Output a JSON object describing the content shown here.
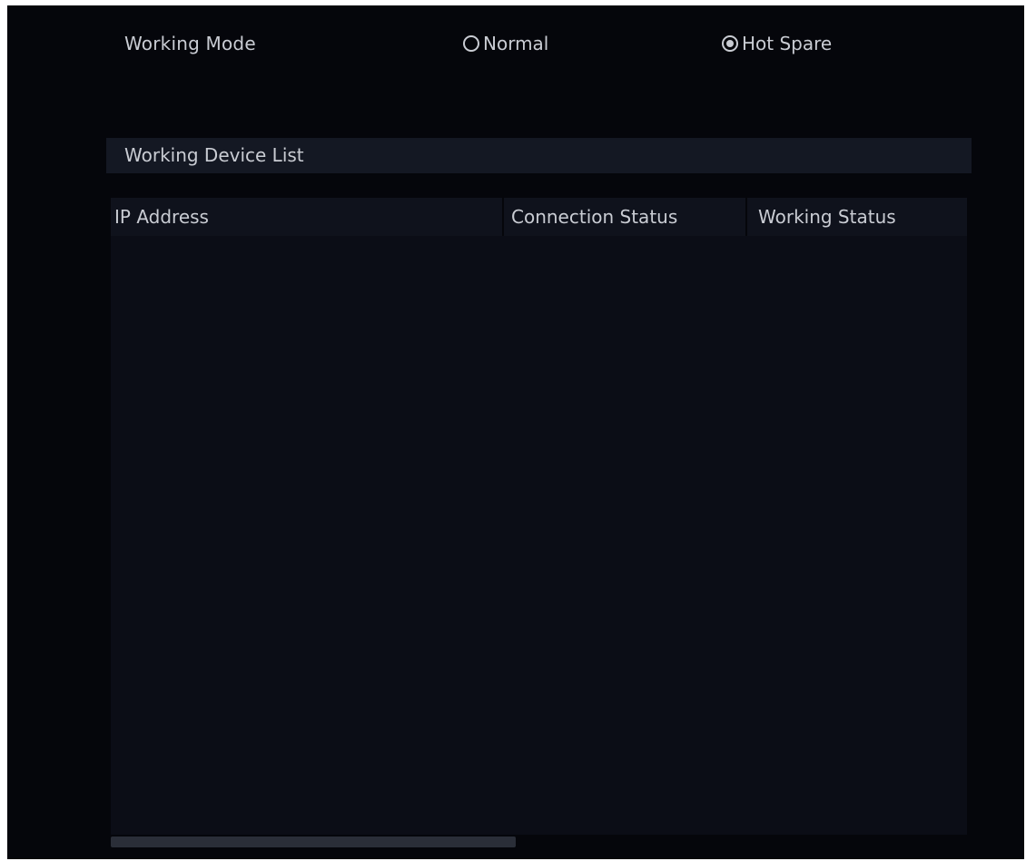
{
  "working_mode": {
    "label": "Working Mode",
    "options": [
      {
        "label": "Normal",
        "selected": false
      },
      {
        "label": "Hot Spare",
        "selected": true
      }
    ]
  },
  "working_device_list": {
    "title": "Working Device List",
    "columns": [
      "IP Address",
      "Connection Status",
      "Working Status"
    ],
    "rows": []
  },
  "colors": {
    "background": "#05060b",
    "panel": "#0b0d16",
    "header": "#141823",
    "text": "#c9ccd3",
    "scrollbar": "#2a2e38"
  }
}
